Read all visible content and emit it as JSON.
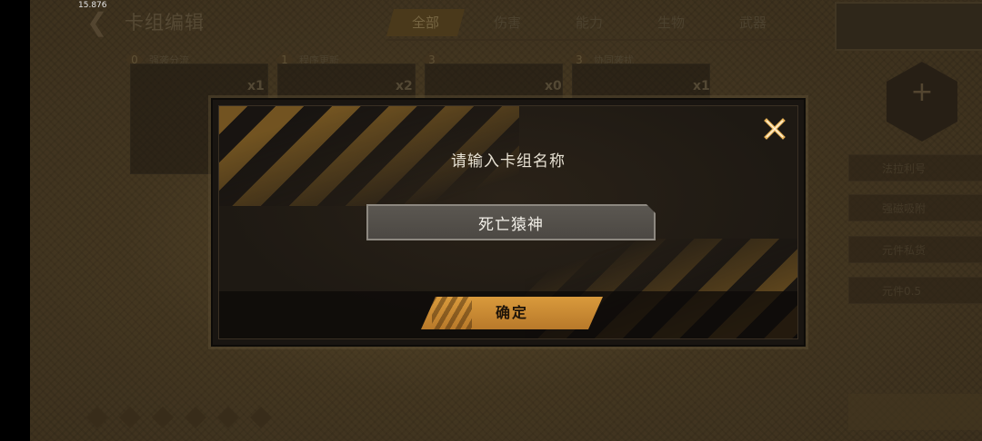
{
  "status": {
    "fps": "15.876"
  },
  "background": {
    "title": "卡组编辑",
    "tabs": [
      "全部",
      "伤害",
      "能力",
      "生物",
      "武器"
    ],
    "active_tab": "全部",
    "categories": [
      {
        "num": "0",
        "label": "强袭分流"
      },
      {
        "num": "1",
        "label": "程序更新"
      },
      {
        "num": "3",
        "label": ""
      },
      {
        "num": "3",
        "label": "协同袭扰"
      }
    ],
    "counts": [
      "x1",
      "x2",
      "x0",
      "x1"
    ],
    "side_items": [
      "法拉利号",
      "强磁吸附",
      "元件私货",
      "元件0.5"
    ]
  },
  "dialog": {
    "title": "请输入卡组名称",
    "input_value": "死亡猿神",
    "confirm_label": "确定",
    "accent_color": "#c98a34"
  }
}
